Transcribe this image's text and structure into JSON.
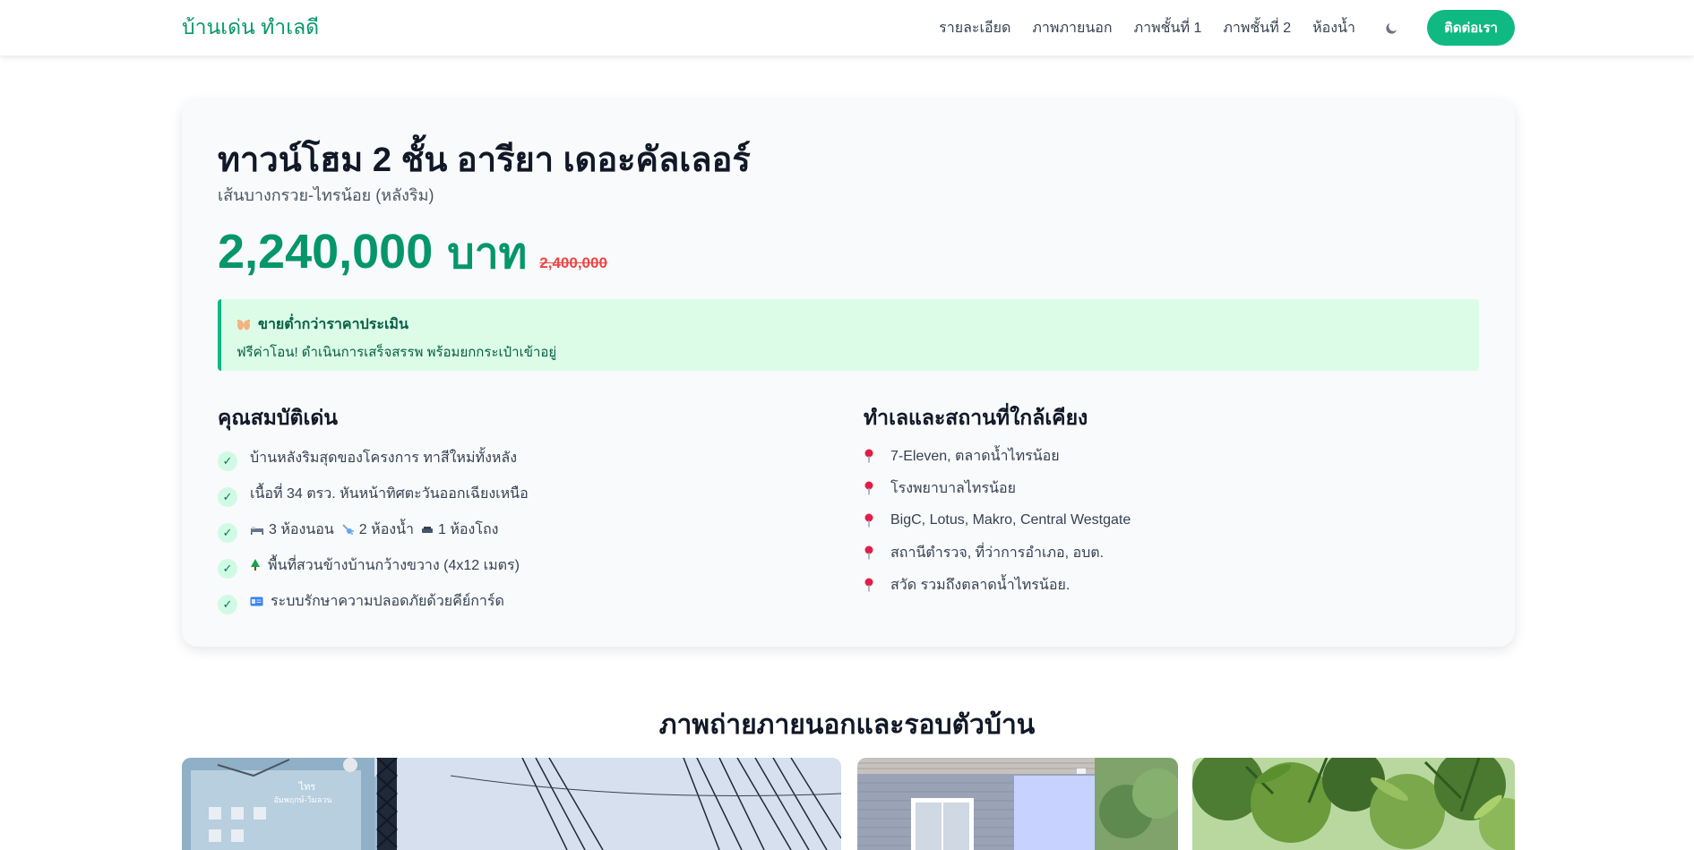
{
  "nav": {
    "brand": "บ้านเด่น ทำเลดี",
    "links": [
      "รายละเอียด",
      "ภาพภายนอก",
      "ภาพชั้นที่ 1",
      "ภาพชั้นที่ 2",
      "ห้องน้ำ"
    ],
    "contact_label": "ติดต่อเรา",
    "theme_icon": "moon-icon"
  },
  "listing": {
    "title": "ทาวน์โฮม 2 ชั้น อารียา เดอะคัลเลอร์",
    "subtitle": "เส้นบางกรวย-ไทรน้อย (หลังริม)",
    "price": "2,240,000",
    "currency": "บาท",
    "old_price": "2,400,000"
  },
  "promo": {
    "title": "ขายต่ำกว่าราคาประเมิน",
    "text": "ฟรีค่าโอน! ดำเนินการเสร็จสรรพ พร้อมยกกระเป๋าเข้าอยู่"
  },
  "features": {
    "title": "คุณสมบัติเด่น",
    "items": [
      "บ้านหลังริมสุดของโครงการ ทาสีใหม่ทั้งหลัง",
      "เนื้อที่ 34 ตรว. หันหน้าทิศตะวันออกเฉียงเหนือ",
      "3 ห้องนอน",
      "2 ห้องน้ำ",
      "1 ห้องโถง",
      "พื้นที่สวนข้างบ้านกว้างขวาง (4x12 เมตร)",
      "ระบบรักษาความปลอดภัยด้วยคีย์การ์ด"
    ]
  },
  "location": {
    "title": "ทำเลและสถานที่ใกล้เคียง",
    "items": [
      "7-Eleven, ตลาดน้ำไทรน้อย",
      "โรงพยาบาลไทรน้อย",
      "BigC, Lotus, Makro, Central Westgate",
      "สถานีตำรวจ, ที่ว่าการอำเภอ, อบต.",
      "สวัด รวมถึงตลาดน้ำไทรน้อย."
    ]
  },
  "gallery": {
    "title": "ภาพถ่ายภายนอกและรอบตัวบ้าน",
    "sign_text": "ไทร\nอัมพฤกษ์-วิมลวน"
  },
  "colors": {
    "accent": "#10b981",
    "price": "#059669",
    "old_price": "#ef4444",
    "promo_bg": "#dcfce7"
  }
}
